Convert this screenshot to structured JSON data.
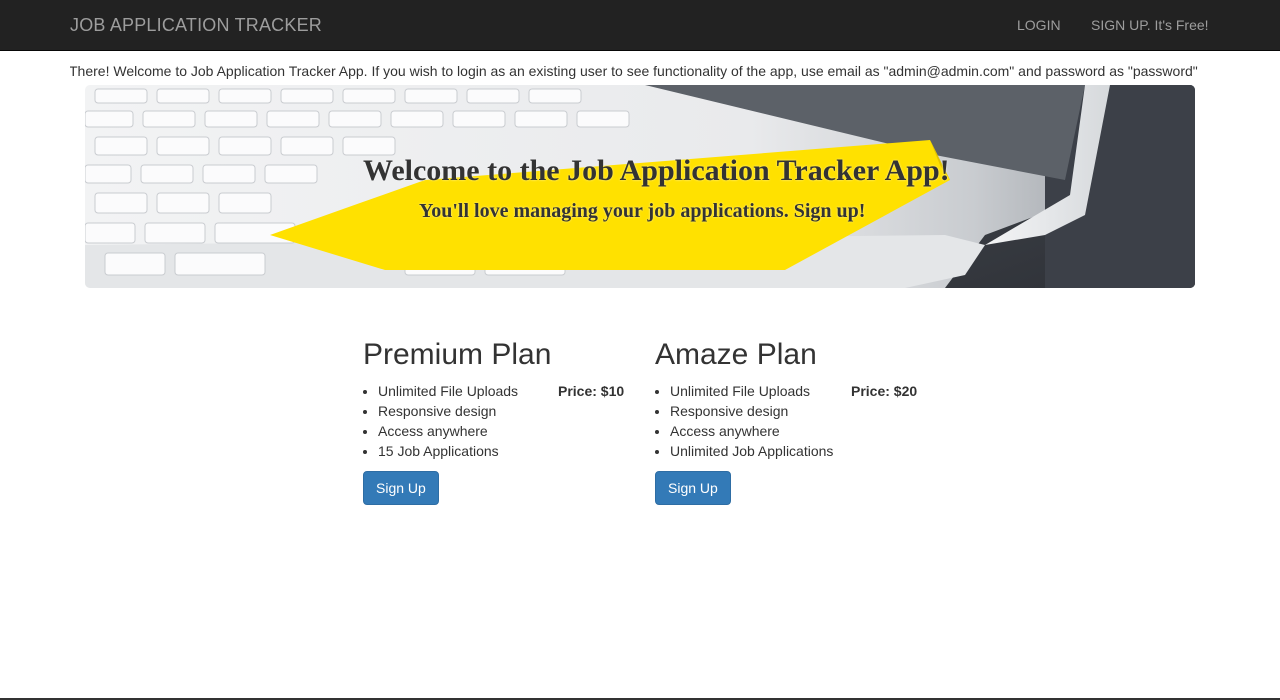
{
  "navbar": {
    "brand": "JOB APPLICATION TRACKER",
    "login_label": "LOGIN",
    "signup_label": "SIGN UP. It's Free!"
  },
  "announcement": {
    "text": "There! Welcome to Job Application Tracker App. If you wish to login as an existing user to see functionality of the app, use email as \"admin@admin.com\" and password as \"password\""
  },
  "hero": {
    "title": "Welcome to the Job Application Tracker App!",
    "subtitle": "You'll love managing your job applications. Sign up!"
  },
  "plans": [
    {
      "title": "Premium Plan",
      "price": "Price: $10",
      "features": [
        "Unlimited File Uploads",
        "Responsive design",
        "Access anywhere",
        "15 Job Applications"
      ],
      "button_label": "Sign Up"
    },
    {
      "title": "Amaze Plan",
      "price": "Price: $20",
      "features": [
        "Unlimited File Uploads",
        "Responsive design",
        "Access anywhere",
        "Unlimited Job Applications"
      ],
      "button_label": "Sign Up"
    }
  ],
  "colors": {
    "navbar_bg": "#222222",
    "navbar_text": "#9d9d9d",
    "button_primary": "#337ab7",
    "sticky_note": "#ffe100"
  }
}
